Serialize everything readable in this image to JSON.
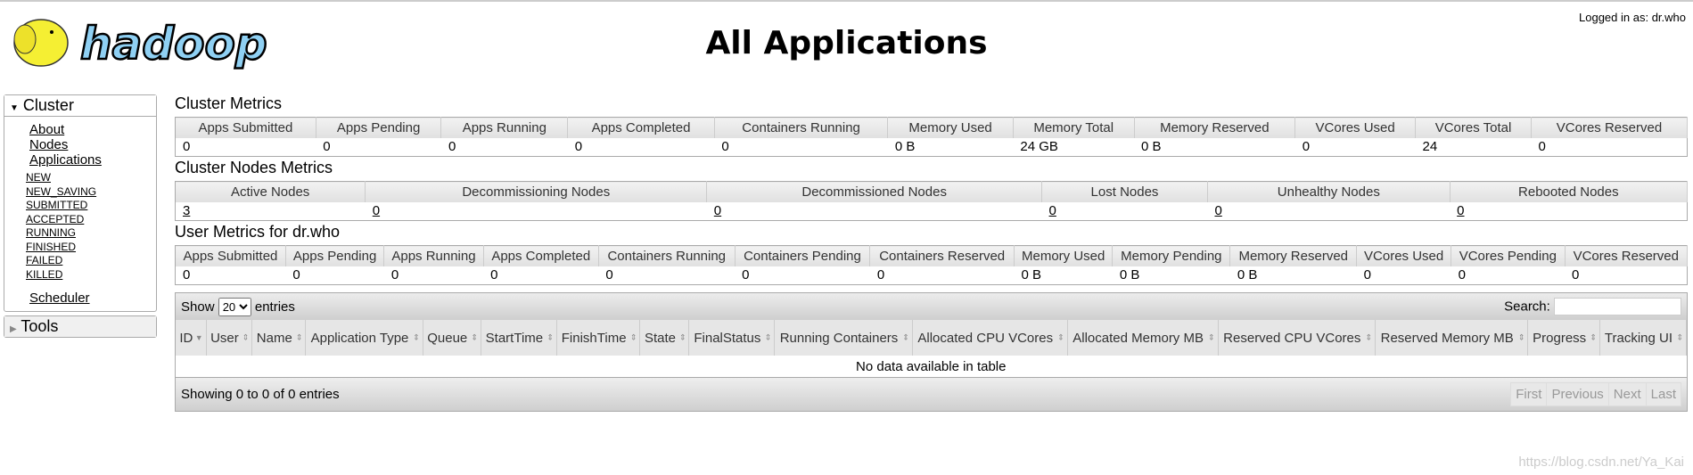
{
  "header": {
    "logo_text": "hadoop",
    "title": "All Applications",
    "logged_in": "Logged in as: dr.who"
  },
  "sidebar": {
    "cluster_label": "Cluster",
    "links": [
      "About",
      "Nodes",
      "Applications"
    ],
    "states": [
      "NEW",
      "NEW_SAVING",
      "SUBMITTED",
      "ACCEPTED",
      "RUNNING",
      "FINISHED",
      "FAILED",
      "KILLED"
    ],
    "scheduler": "Scheduler",
    "tools_label": "Tools"
  },
  "cluster_metrics": {
    "title": "Cluster Metrics",
    "headers": [
      "Apps Submitted",
      "Apps Pending",
      "Apps Running",
      "Apps Completed",
      "Containers Running",
      "Memory Used",
      "Memory Total",
      "Memory Reserved",
      "VCores Used",
      "VCores Total",
      "VCores Reserved"
    ],
    "values": [
      "0",
      "0",
      "0",
      "0",
      "0",
      "0 B",
      "24 GB",
      "0 B",
      "0",
      "24",
      "0"
    ]
  },
  "nodes_metrics": {
    "title": "Cluster Nodes Metrics",
    "headers": [
      "Active Nodes",
      "Decommissioning Nodes",
      "Decommissioned Nodes",
      "Lost Nodes",
      "Unhealthy Nodes",
      "Rebooted Nodes"
    ],
    "values": [
      "3",
      "0",
      "0",
      "0",
      "0",
      "0"
    ]
  },
  "user_metrics": {
    "title": "User Metrics for dr.who",
    "headers": [
      "Apps Submitted",
      "Apps Pending",
      "Apps Running",
      "Apps Completed",
      "Containers Running",
      "Containers Pending",
      "Containers Reserved",
      "Memory Used",
      "Memory Pending",
      "Memory Reserved",
      "VCores Used",
      "VCores Pending",
      "VCores Reserved"
    ],
    "values": [
      "0",
      "0",
      "0",
      "0",
      "0",
      "0",
      "0",
      "0 B",
      "0 B",
      "0 B",
      "0",
      "0",
      "0"
    ]
  },
  "apps_table": {
    "show": "Show",
    "entries_value": "20",
    "entries": "entries",
    "search_label": "Search:",
    "search_value": "",
    "columns": [
      "ID",
      "User",
      "Name",
      "Application Type",
      "Queue",
      "StartTime",
      "FinishTime",
      "State",
      "FinalStatus",
      "Running Containers",
      "Allocated CPU VCores",
      "Allocated Memory MB",
      "Reserved CPU VCores",
      "Reserved Memory MB",
      "Progress",
      "Tracking UI"
    ],
    "empty": "No data available in table",
    "info": "Showing 0 to 0 of 0 entries",
    "pager": [
      "First",
      "Previous",
      "Next",
      "Last"
    ]
  },
  "watermark": "https://blog.csdn.net/Ya_Kai"
}
